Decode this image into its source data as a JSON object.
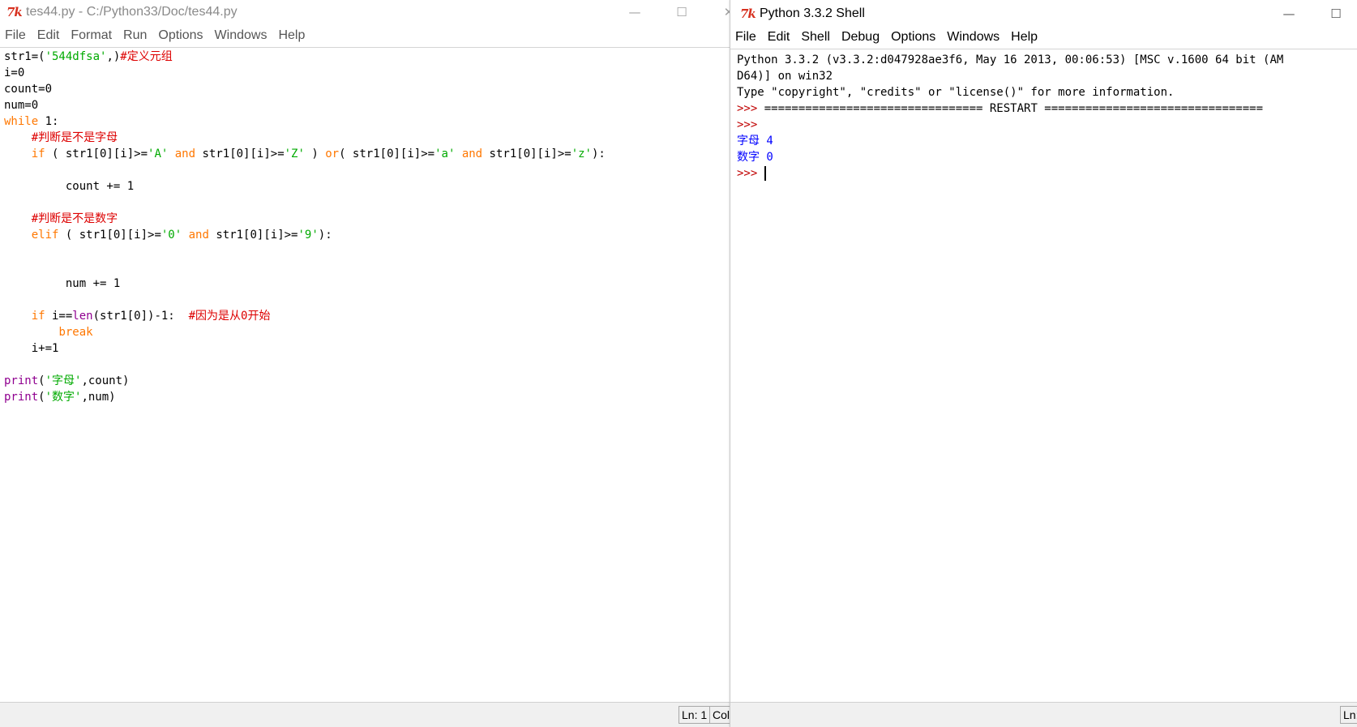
{
  "editor": {
    "title": "tes44.py - C:/Python33/Doc/tes44.py",
    "menu": [
      "File",
      "Edit",
      "Format",
      "Run",
      "Options",
      "Windows",
      "Help"
    ],
    "code": [
      [
        {
          "t": "str1=(",
          "c": ""
        },
        {
          "t": "'544dfsa'",
          "c": "str"
        },
        {
          "t": ",)",
          "c": ""
        },
        {
          "t": "#定义元组",
          "c": "cmt"
        }
      ],
      [
        {
          "t": "i=0",
          "c": ""
        }
      ],
      [
        {
          "t": "count=0",
          "c": ""
        }
      ],
      [
        {
          "t": "num=0",
          "c": ""
        }
      ],
      [
        {
          "t": "while",
          "c": "kw"
        },
        {
          "t": " 1:",
          "c": ""
        }
      ],
      [
        {
          "t": "    ",
          "c": ""
        },
        {
          "t": "#判断是不是字母",
          "c": "cmt"
        }
      ],
      [
        {
          "t": "    ",
          "c": ""
        },
        {
          "t": "if",
          "c": "kw"
        },
        {
          "t": " ( str1[0][i]>=",
          "c": ""
        },
        {
          "t": "'A'",
          "c": "str"
        },
        {
          "t": " ",
          "c": ""
        },
        {
          "t": "and",
          "c": "kw"
        },
        {
          "t": " str1[0][i]>=",
          "c": ""
        },
        {
          "t": "'Z'",
          "c": "str"
        },
        {
          "t": " ) ",
          "c": ""
        },
        {
          "t": "or",
          "c": "kw"
        },
        {
          "t": "( str1[0][i]>=",
          "c": ""
        },
        {
          "t": "'a'",
          "c": "str"
        },
        {
          "t": " ",
          "c": ""
        },
        {
          "t": "and",
          "c": "kw"
        },
        {
          "t": " str1[0][i]>=",
          "c": ""
        },
        {
          "t": "'z'",
          "c": "str"
        },
        {
          "t": "):",
          "c": ""
        }
      ],
      [],
      [
        {
          "t": "         count += 1",
          "c": ""
        }
      ],
      [],
      [
        {
          "t": "    ",
          "c": ""
        },
        {
          "t": "#判断是不是数字",
          "c": "cmt"
        }
      ],
      [
        {
          "t": "    ",
          "c": ""
        },
        {
          "t": "elif",
          "c": "kw"
        },
        {
          "t": " ( str1[0][i]>=",
          "c": ""
        },
        {
          "t": "'0'",
          "c": "str"
        },
        {
          "t": " ",
          "c": ""
        },
        {
          "t": "and",
          "c": "kw"
        },
        {
          "t": " str1[0][i]>=",
          "c": ""
        },
        {
          "t": "'9'",
          "c": "str"
        },
        {
          "t": "):",
          "c": ""
        }
      ],
      [],
      [],
      [
        {
          "t": "         num += 1",
          "c": ""
        }
      ],
      [],
      [
        {
          "t": "    ",
          "c": ""
        },
        {
          "t": "if",
          "c": "kw"
        },
        {
          "t": " i==",
          "c": ""
        },
        {
          "t": "len",
          "c": "bi"
        },
        {
          "t": "(str1[0])-1:  ",
          "c": ""
        },
        {
          "t": "#因为是从0开始",
          "c": "cmt"
        }
      ],
      [
        {
          "t": "        ",
          "c": ""
        },
        {
          "t": "break",
          "c": "kw"
        }
      ],
      [
        {
          "t": "    i+=1",
          "c": ""
        }
      ],
      [],
      [
        {
          "t": "print",
          "c": "bi"
        },
        {
          "t": "(",
          "c": ""
        },
        {
          "t": "'字母'",
          "c": "str"
        },
        {
          "t": ",count)",
          "c": ""
        }
      ],
      [
        {
          "t": "print",
          "c": "bi"
        },
        {
          "t": "(",
          "c": ""
        },
        {
          "t": "'数字'",
          "c": "str"
        },
        {
          "t": ",num)",
          "c": ""
        }
      ]
    ],
    "status": {
      "ln": "Ln: 1",
      "col": "Col"
    }
  },
  "shell": {
    "title": "Python 3.3.2 Shell",
    "menu": [
      "File",
      "Edit",
      "Shell",
      "Debug",
      "Options",
      "Windows",
      "Help"
    ],
    "lines": [
      [
        {
          "t": "Python 3.3.2 (v3.3.2:d047928ae3f6, May 16 2013, 00:06:53) [MSC v.1600 64 bit (AM",
          "c": ""
        }
      ],
      [
        {
          "t": "D64)] on win32",
          "c": ""
        }
      ],
      [
        {
          "t": "Type \"copyright\", \"credits\" or \"license()\" for more information.",
          "c": ""
        }
      ],
      [
        {
          "t": ">>> ",
          "c": "prompt"
        },
        {
          "t": "================================ RESTART ================================",
          "c": ""
        }
      ],
      [
        {
          "t": ">>>",
          "c": "prompt"
        }
      ],
      [
        {
          "t": "字母 4",
          "c": "out"
        }
      ],
      [
        {
          "t": "数字 0",
          "c": "out"
        }
      ],
      [
        {
          "t": ">>> ",
          "c": "prompt"
        },
        {
          "t": "",
          "c": "cursor"
        }
      ]
    ],
    "status": {
      "ln": "Ln:"
    }
  },
  "controls": {
    "minimize": "—",
    "maximize": "☐",
    "close": "✕"
  },
  "logo": "7k"
}
